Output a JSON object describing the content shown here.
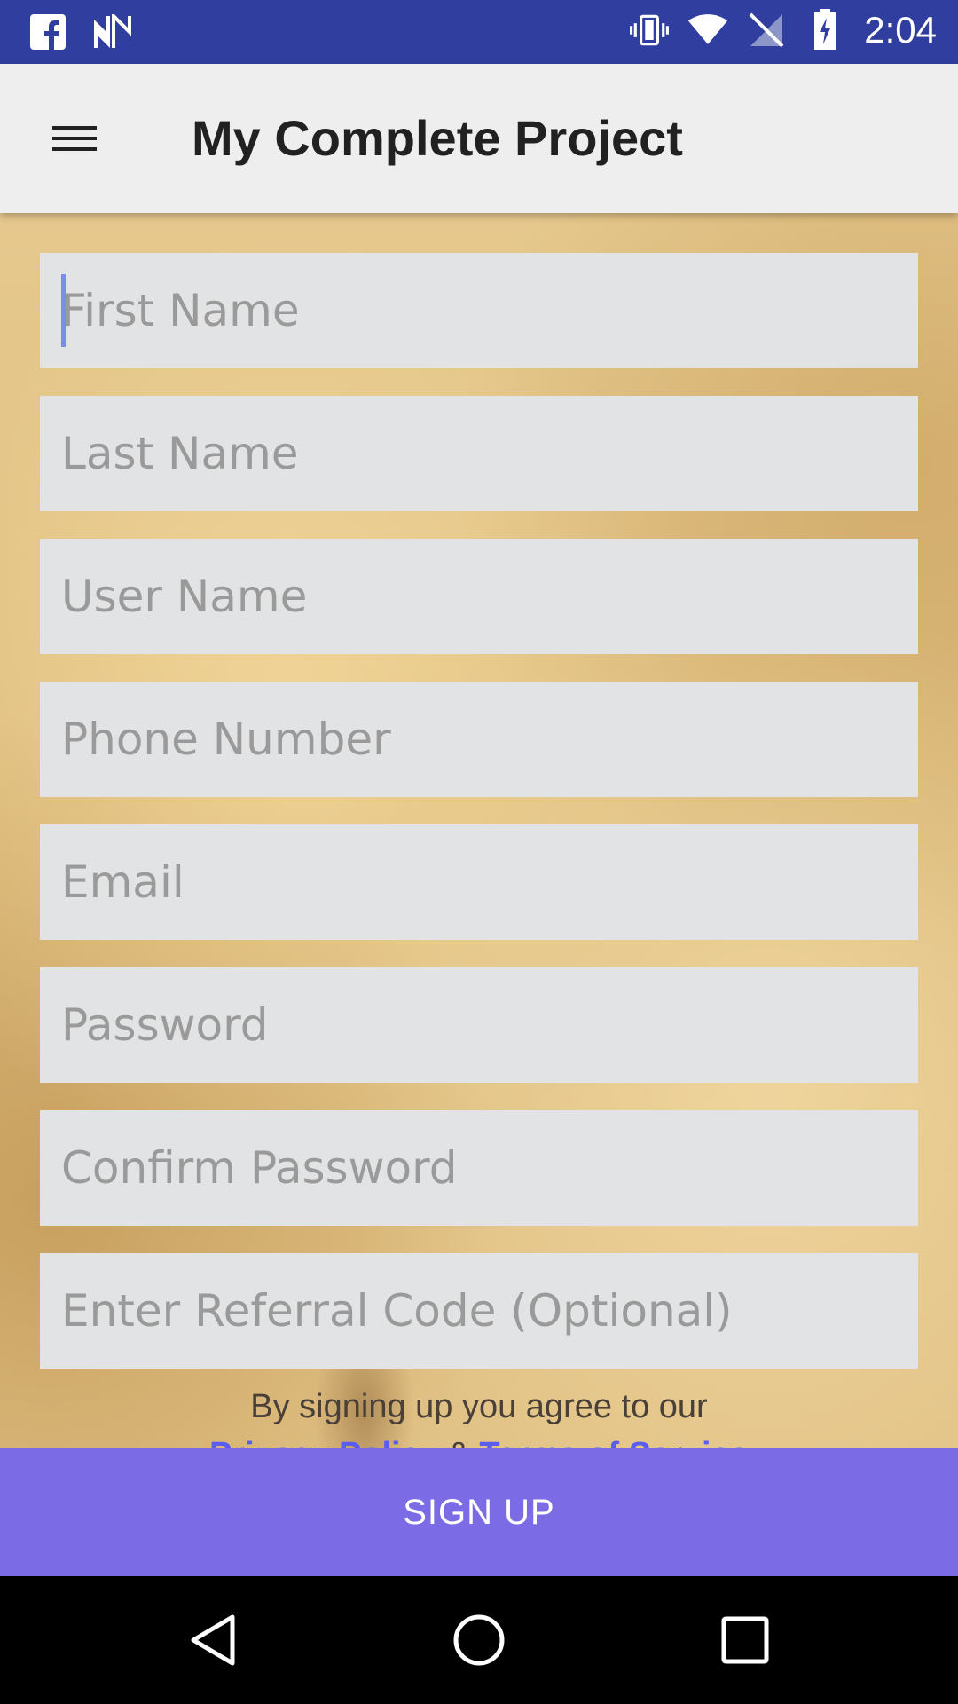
{
  "status_bar": {
    "left_icons": [
      "facebook-icon",
      "n-app-icon"
    ],
    "right_icons": [
      "vibrate-icon",
      "wifi-icon",
      "no-signal-icon",
      "battery-charging-icon"
    ],
    "time": "2:04",
    "color": "#303F9F"
  },
  "app_bar": {
    "title": "My Complete Project",
    "menu_icon": "hamburger-menu-icon"
  },
  "form": {
    "fields": [
      {
        "placeholder": "First Name",
        "value": ""
      },
      {
        "placeholder": "Last Name",
        "value": ""
      },
      {
        "placeholder": "User Name",
        "value": ""
      },
      {
        "placeholder": "Phone Number",
        "value": ""
      },
      {
        "placeholder": "Email",
        "value": ""
      },
      {
        "placeholder": "Password",
        "value": ""
      },
      {
        "placeholder": "Confirm Password",
        "value": ""
      },
      {
        "placeholder": "Enter Referral Code (Optional)",
        "value": ""
      }
    ],
    "terms_text": "By signing up you agree to our",
    "privacy_link": "Privacy Policy",
    "amp": "&",
    "terms_link": "Terms of Service",
    "link_color": "#5a5ef0"
  },
  "signup": {
    "label": "SIGN UP",
    "color": "#7B6CE6"
  },
  "nav_bar": {
    "icons": [
      "back-icon",
      "home-icon",
      "recents-icon"
    ]
  }
}
